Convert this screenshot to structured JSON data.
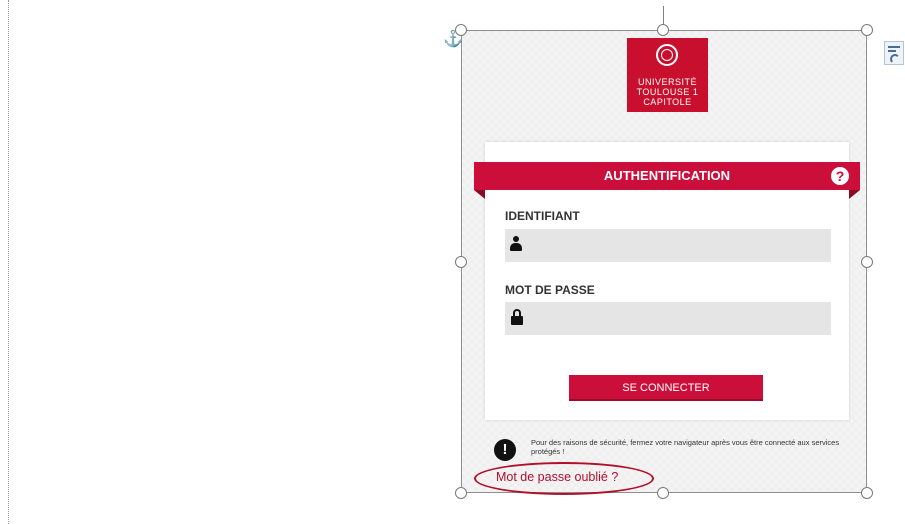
{
  "logo": {
    "name": "university-logo",
    "lines": [
      "UNIVERSITÉ",
      "TOULOUSE 1",
      "CAPITOLE"
    ]
  },
  "auth": {
    "title": "AUTHENTIFICATION",
    "help_glyph": "?",
    "identifiant_label": "IDENTIFIANT",
    "identifiant_value": "",
    "password_label": "MOT DE PASSE",
    "password_value": "",
    "connect_button": "SE CONNECTER"
  },
  "notice": {
    "icon_glyph": "!",
    "text": "Pour des raisons de sécurité, fermez votre navigateur après vous être connecté aux services protégés !"
  },
  "forgot_link": "Mot de passe oublié ?",
  "icons": [
    "anchor-icon",
    "layout-options-icon",
    "user-icon",
    "lock-icon",
    "help-icon",
    "warning-icon"
  ],
  "colors": {
    "brand_red": "#cc0e3a",
    "logo_red": "#c8102e",
    "annotation_red": "#b0102a",
    "input_gray": "#e5e5e5"
  }
}
